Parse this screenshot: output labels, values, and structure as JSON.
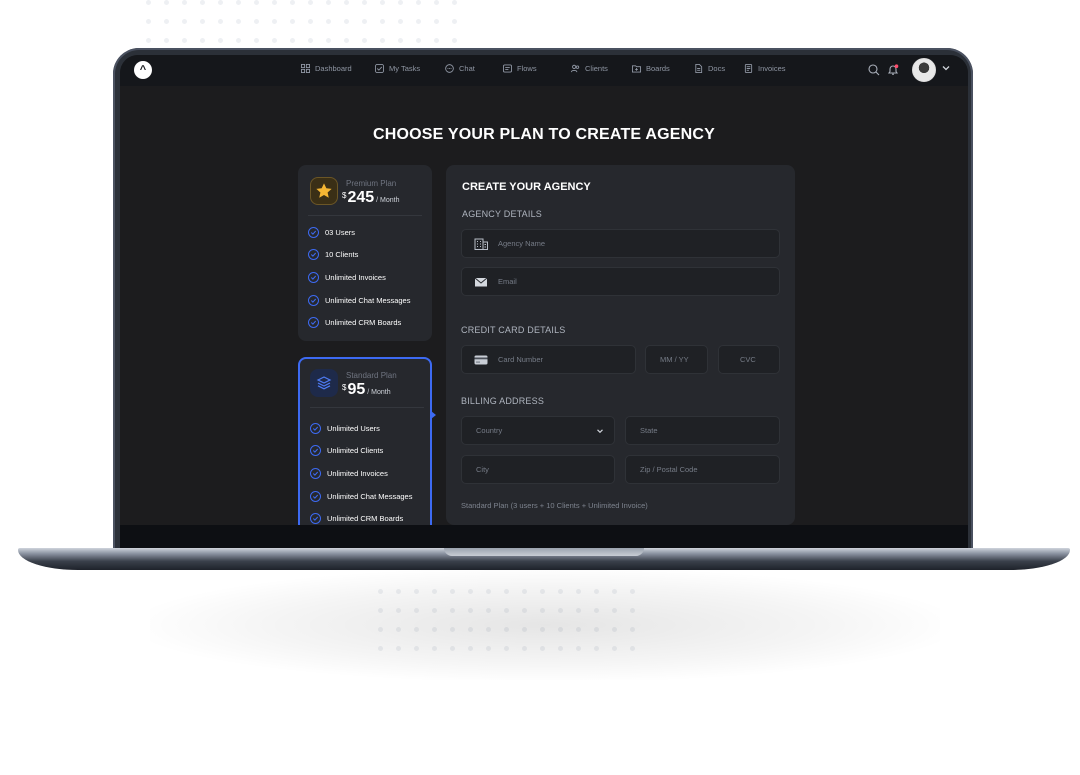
{
  "nav": {
    "items": [
      {
        "label": "Dashboard",
        "icon": "grid-icon"
      },
      {
        "label": "My Tasks",
        "icon": "checkbox-icon"
      },
      {
        "label": "Chat",
        "icon": "chat-bubble-icon"
      },
      {
        "label": "Flows",
        "icon": "flow-icon"
      },
      {
        "label": "Clients",
        "icon": "users-icon"
      },
      {
        "label": "Boards",
        "icon": "folder-icon"
      },
      {
        "label": "Docs",
        "icon": "document-icon"
      },
      {
        "label": "Invoices",
        "icon": "invoice-icon"
      }
    ]
  },
  "page": {
    "title": "CHOOSE YOUR PLAN TO CREATE AGENCY"
  },
  "plans": [
    {
      "name": "Premium Plan",
      "currency": "$",
      "price": "245",
      "period": "/ Month",
      "icon": "star-icon",
      "features": [
        "03 Users",
        "10 Clients",
        "Unlimited Invoices",
        "Unlimited Chat Messages",
        "Unlimited CRM Boards"
      ]
    },
    {
      "name": "Standard Plan",
      "currency": "$",
      "price": "95",
      "period": "/ Month",
      "icon": "layers-icon",
      "selected": true,
      "features": [
        "Unlimited Users",
        "Unlimited Clients",
        "Unlimited Invoices",
        "Unlimited Chat Messages",
        "Unlimited CRM Boards"
      ]
    }
  ],
  "form": {
    "title": "CREATE YOUR AGENCY",
    "agency_section": "AGENCY DETAILS",
    "agency_name_placeholder": "Agency Name",
    "email_placeholder": "Email",
    "card_section": "CREDIT CARD DETAILS",
    "card_number_placeholder": "Card Number",
    "expiry_placeholder": "MM / YY",
    "cvc_placeholder": "CVC",
    "billing_section": "BILLING ADDRESS",
    "country_placeholder": "Country",
    "state_placeholder": "State",
    "city_placeholder": "City",
    "zip_placeholder": "Zip / Postal Code",
    "summary": "Standard Plan (3 users + 10 Clients + Unlimited Invoice)"
  },
  "colors": {
    "accent": "#3d6af2",
    "star": "#f5b633",
    "screen_bg": "#1c1c1e",
    "card_bg": "#26282d"
  }
}
